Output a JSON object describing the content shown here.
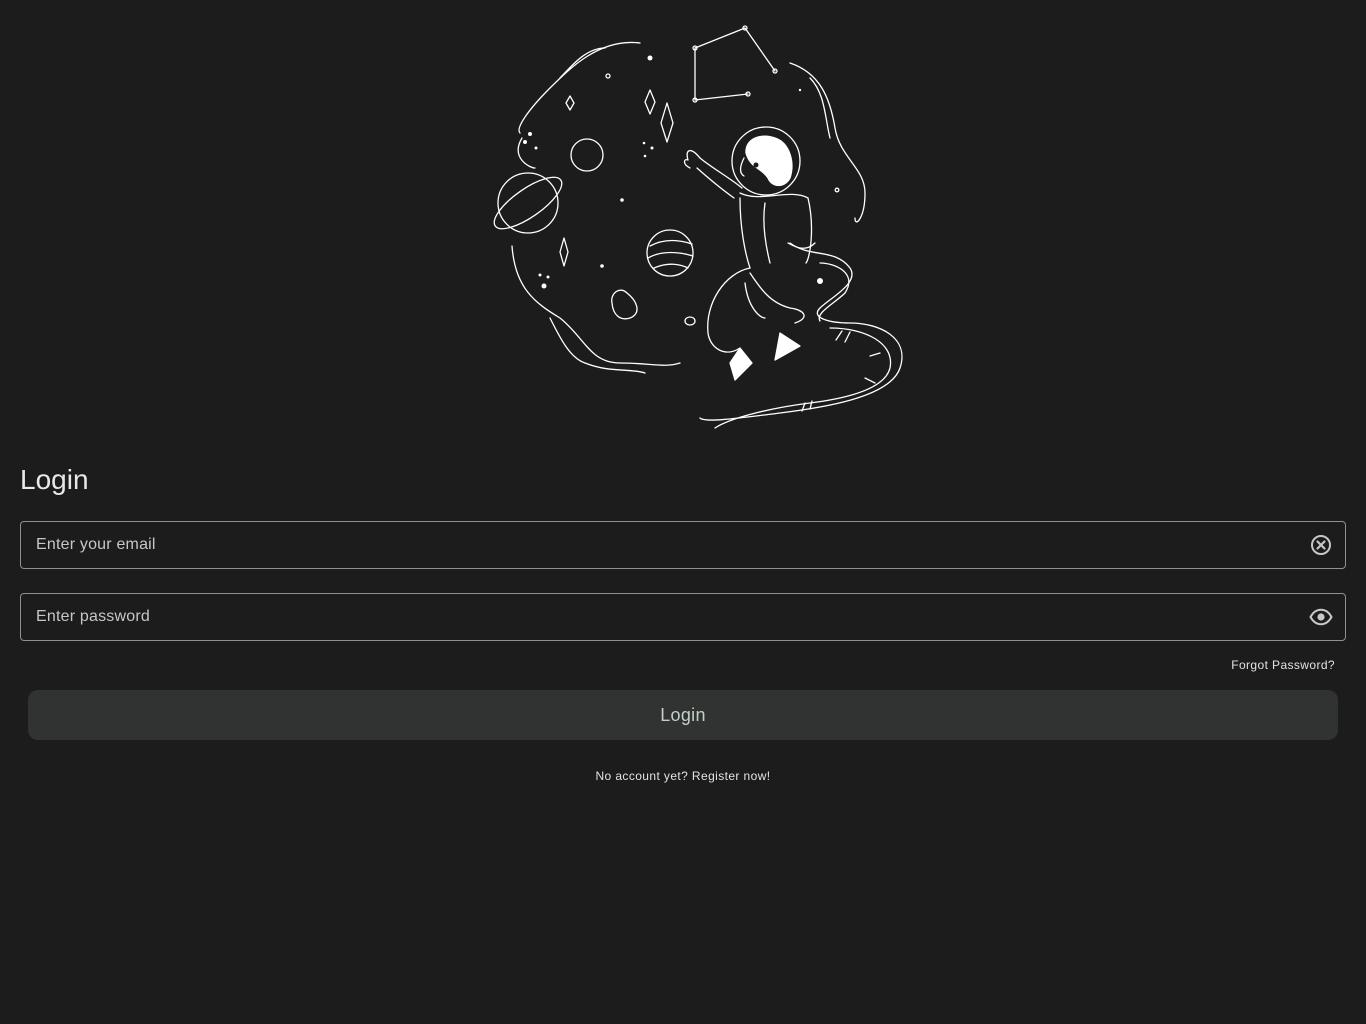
{
  "login": {
    "title": "Login",
    "email": {
      "placeholder": "Enter your email",
      "value": ""
    },
    "password": {
      "placeholder": "Enter password",
      "value": ""
    },
    "forgot_password": "Forgot Password?",
    "submit_label": "Login",
    "register_prompt": "No account yet? Register now!"
  },
  "icons": {
    "email_trailing": "clear-circle-icon",
    "password_trailing": "eye-icon",
    "hero": "astronaut-space-illustration"
  },
  "colors": {
    "background": "#1b1c1b",
    "field_border": "#8f918f",
    "button_bg": "#313332",
    "button_text": "#c2d0c6",
    "text": "#e7e7e6"
  }
}
